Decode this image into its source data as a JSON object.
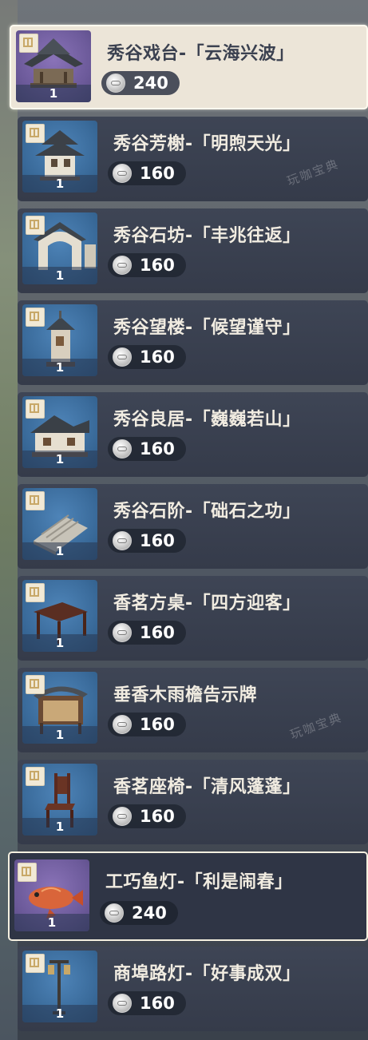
{
  "items": [
    {
      "name": "秀谷戏台-「云海兴波」",
      "price": "240",
      "count": "1",
      "icon": "stage-building-icon",
      "bg": "purple",
      "selected": true
    },
    {
      "name": "秀谷芳榭-「明煦天光」",
      "price": "160",
      "count": "1",
      "icon": "pavilion-building-icon",
      "bg": "blue"
    },
    {
      "name": "秀谷石坊-「丰兆往返」",
      "price": "160",
      "count": "1",
      "icon": "stone-archway-icon",
      "bg": "blue"
    },
    {
      "name": "秀谷望楼-「候望谨守」",
      "price": "160",
      "count": "1",
      "icon": "watchtower-icon",
      "bg": "blue"
    },
    {
      "name": "秀谷良居-「巍巍若山」",
      "price": "160",
      "count": "1",
      "icon": "house-icon",
      "bg": "blue"
    },
    {
      "name": "秀谷石阶-「础石之功」",
      "price": "160",
      "count": "1",
      "icon": "stone-steps-icon",
      "bg": "blue"
    },
    {
      "name": "香茗方桌-「四方迎客」",
      "price": "160",
      "count": "1",
      "icon": "square-table-icon",
      "bg": "blue"
    },
    {
      "name": "垂香木雨檐告示牌",
      "price": "160",
      "count": "1",
      "icon": "notice-board-icon",
      "bg": "blue"
    },
    {
      "name": "香茗座椅-「清风蓬蓬」",
      "price": "160",
      "count": "1",
      "icon": "wooden-chair-icon",
      "bg": "blue"
    },
    {
      "name": "工巧鱼灯-「利是闹春」",
      "price": "240",
      "count": "1",
      "icon": "fish-lantern-icon",
      "bg": "purple",
      "selected": true
    },
    {
      "name": "商埠路灯-「好事成双」",
      "price": "160",
      "count": "1",
      "icon": "street-lamp-icon",
      "bg": "blue"
    }
  ],
  "watermark_text": "玩咖宝典",
  "colors": {
    "row_bg": "#3e4555",
    "selected_bg": "#ece5d8",
    "rare_thumb": "#6c5a9a",
    "common_thumb": "#3b6c9c",
    "text": "#f1ece1"
  }
}
